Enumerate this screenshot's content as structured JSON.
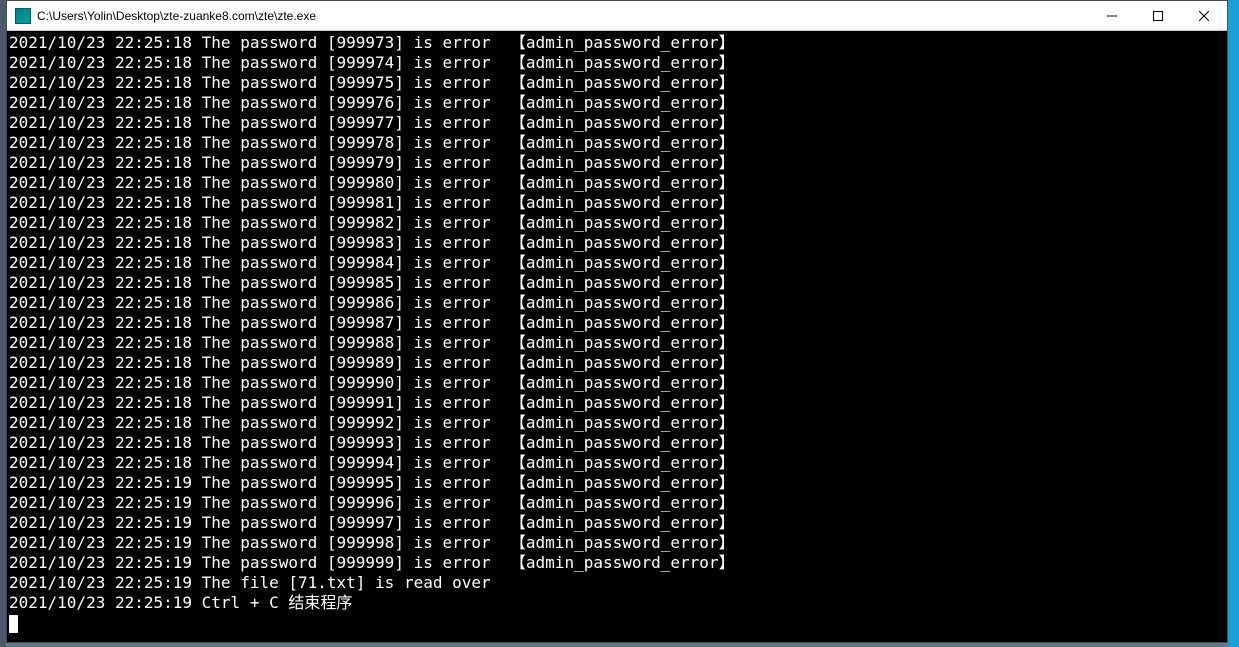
{
  "window": {
    "title": "C:\\Users\\Yolin\\Desktop\\zte-zuanke8.com\\zte\\zte.exe"
  },
  "log": {
    "prefix_ts1": "2021/10/23 22:25:18",
    "prefix_ts2": "2021/10/23 22:25:19",
    "template_pw": "The password [{n}] is error  【admin_password_error】",
    "entries": [
      {
        "ts": "2021/10/23 22:25:18",
        "n": "999973"
      },
      {
        "ts": "2021/10/23 22:25:18",
        "n": "999974"
      },
      {
        "ts": "2021/10/23 22:25:18",
        "n": "999975"
      },
      {
        "ts": "2021/10/23 22:25:18",
        "n": "999976"
      },
      {
        "ts": "2021/10/23 22:25:18",
        "n": "999977"
      },
      {
        "ts": "2021/10/23 22:25:18",
        "n": "999978"
      },
      {
        "ts": "2021/10/23 22:25:18",
        "n": "999979"
      },
      {
        "ts": "2021/10/23 22:25:18",
        "n": "999980"
      },
      {
        "ts": "2021/10/23 22:25:18",
        "n": "999981"
      },
      {
        "ts": "2021/10/23 22:25:18",
        "n": "999982"
      },
      {
        "ts": "2021/10/23 22:25:18",
        "n": "999983"
      },
      {
        "ts": "2021/10/23 22:25:18",
        "n": "999984"
      },
      {
        "ts": "2021/10/23 22:25:18",
        "n": "999985"
      },
      {
        "ts": "2021/10/23 22:25:18",
        "n": "999986"
      },
      {
        "ts": "2021/10/23 22:25:18",
        "n": "999987"
      },
      {
        "ts": "2021/10/23 22:25:18",
        "n": "999988"
      },
      {
        "ts": "2021/10/23 22:25:18",
        "n": "999989"
      },
      {
        "ts": "2021/10/23 22:25:18",
        "n": "999990"
      },
      {
        "ts": "2021/10/23 22:25:18",
        "n": "999991"
      },
      {
        "ts": "2021/10/23 22:25:18",
        "n": "999992"
      },
      {
        "ts": "2021/10/23 22:25:18",
        "n": "999993"
      },
      {
        "ts": "2021/10/23 22:25:18",
        "n": "999994"
      },
      {
        "ts": "2021/10/23 22:25:19",
        "n": "999995"
      },
      {
        "ts": "2021/10/23 22:25:19",
        "n": "999996"
      },
      {
        "ts": "2021/10/23 22:25:19",
        "n": "999997"
      },
      {
        "ts": "2021/10/23 22:25:19",
        "n": "999998"
      },
      {
        "ts": "2021/10/23 22:25:19",
        "n": "999999"
      }
    ],
    "file_line": "2021/10/23 22:25:19 The file [71.txt] is read over",
    "end_line": "2021/10/23 22:25:19 Ctrl + C 结束程序"
  }
}
